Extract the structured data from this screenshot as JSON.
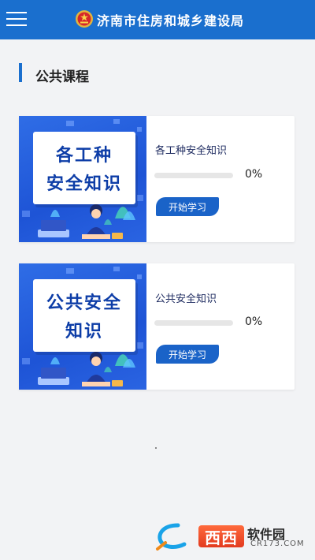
{
  "header": {
    "title": "济南市住房和城乡建设局",
    "emblem_icon": "national-emblem-icon",
    "menu_icon": "hamburger-menu-icon",
    "color": "#1a6fce"
  },
  "section": {
    "title": "公共课程"
  },
  "courses": [
    {
      "thumb_line1": "各工种",
      "thumb_line2": "安全知识",
      "title": "各工种安全知识",
      "progress": 0,
      "progress_label": "0%",
      "button_label": "开始学习"
    },
    {
      "thumb_line1": "公共安全",
      "thumb_line2": "知识",
      "title": "公共安全知识",
      "progress": 0,
      "progress_label": "0%",
      "button_label": "开始学习"
    }
  ],
  "watermark": {
    "tag": "西西",
    "name": "软件园",
    "url": "CR173.COM"
  },
  "colors": {
    "accent": "#1a6fce",
    "button": "#1a63c8",
    "thumb_blue": "#2f6de6",
    "thumb_text": "#0d3da7"
  }
}
